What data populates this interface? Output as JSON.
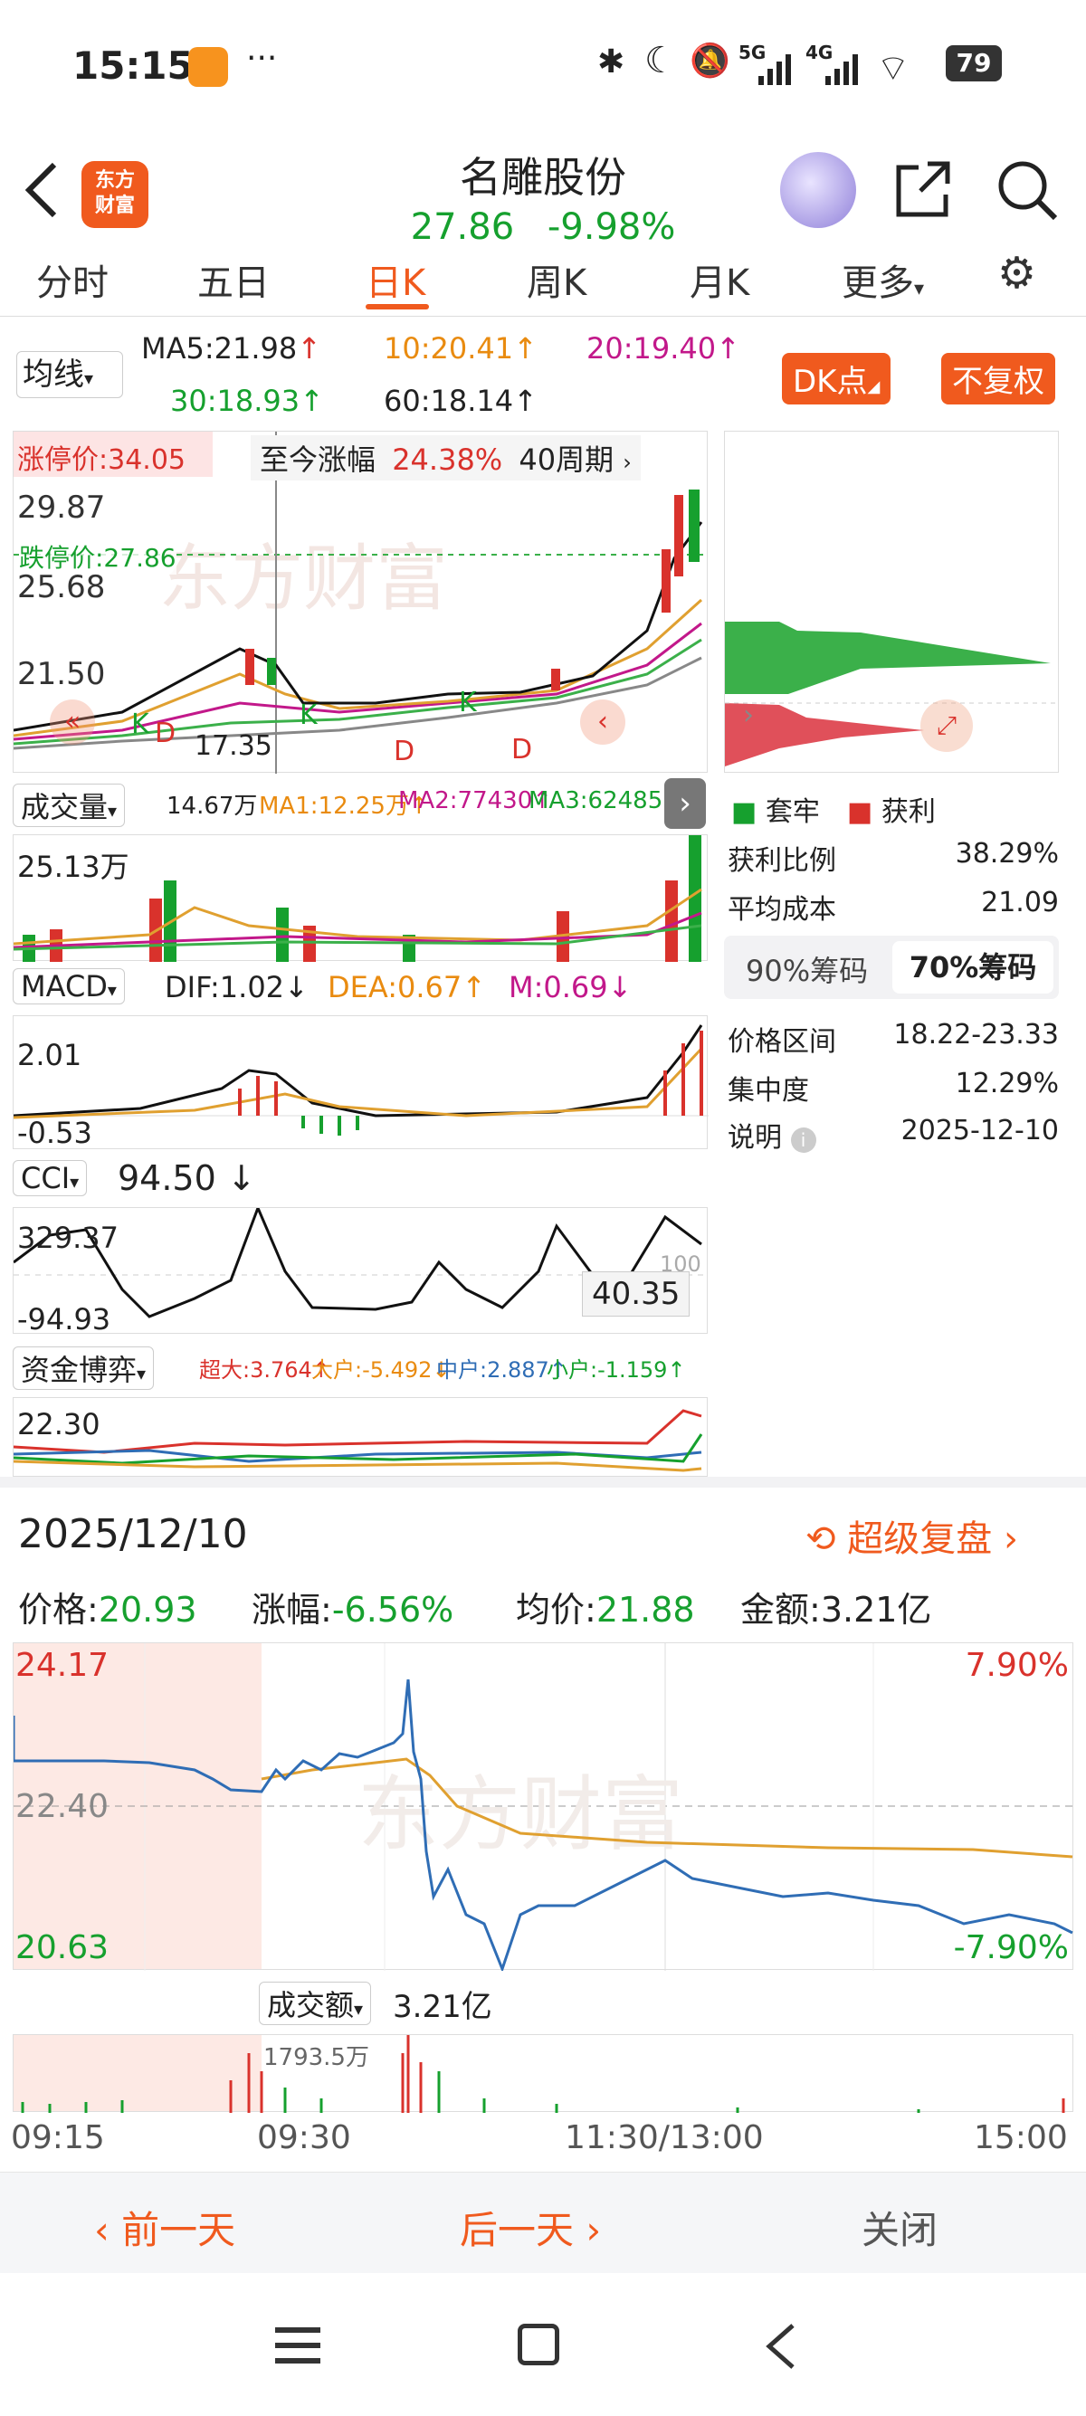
{
  "status_bar": {
    "time": "15:15",
    "network_labels": [
      "5G",
      "4G"
    ],
    "battery": "79"
  },
  "header": {
    "back_icon": "back-chevron-icon",
    "app_logo": "东方财富",
    "stock_name": "名雕股份",
    "price": "27.86",
    "change_pct": "-9.98%"
  },
  "tabs": [
    "分时",
    "五日",
    "日K",
    "周K",
    "月K",
    "更多"
  ],
  "active_tab": "日K",
  "ma_row": {
    "select": "均线",
    "ma5": "MA5:21.98",
    "ma10": "10:20.41",
    "ma20": "20:19.40",
    "ma30": "30:18.93",
    "ma60": "60:18.14",
    "dk_button": "DK点",
    "adjust_button": "不复权"
  },
  "kchart": {
    "limit_up_label": "涨停价:34.05",
    "range_label": "至今涨幅",
    "range_value": "24.38%",
    "period": "40周期",
    "y_labels": [
      "29.87",
      "25.68",
      "21.50"
    ],
    "limit_down_label": "跌停价:27.86",
    "low_label": "17.35",
    "k_marks": [
      "K",
      "D",
      "K",
      "K",
      "D",
      "D"
    ],
    "watermark": "东方财富"
  },
  "chips": {
    "legend_hold": "套牢",
    "legend_profit": "获利",
    "profit_ratio_label": "获利比例",
    "profit_ratio": "38.29%",
    "avg_cost_label": "平均成本",
    "avg_cost": "21.09",
    "tab_90": "90%筹码",
    "tab_70": "70%筹码",
    "price_range_label": "价格区间",
    "price_range": "18.22-23.33",
    "concentration_label": "集中度",
    "concentration": "12.29%",
    "note_label": "说明",
    "note_date": "2025-12-10"
  },
  "volume": {
    "select": "成交量",
    "vol": "14.67万",
    "ma1": "MA1:12.25万",
    "ma2": "MA2:77430",
    "ma3": "MA3:62485",
    "y_label": "25.13万"
  },
  "macd": {
    "select": "MACD",
    "dif": "DIF:1.02",
    "dea": "DEA:0.67",
    "m": "M:0.69",
    "y_top": "2.01",
    "y_bottom": "-0.53"
  },
  "cci": {
    "select": "CCI",
    "value": "94.50",
    "y_top": "329.37",
    "y_bottom": "-94.93",
    "y_mid": "100",
    "tooltip": "40.35"
  },
  "fund": {
    "select": "资金博弈",
    "super": "超大:3.764",
    "large": "大户:-5.492",
    "medium": "中户:2.887",
    "small": "小户:-1.159",
    "y_label": "22.30"
  },
  "day": {
    "date": "2025/12/10",
    "replay": "超级复盘",
    "price_label": "价格:",
    "price": "20.93",
    "change_label": "涨幅:",
    "change": "-6.56%",
    "avg_label": "均价:",
    "avg": "21.88",
    "amount_label": "金额:",
    "amount": "3.21亿",
    "y_high": "24.17",
    "y_mid": "22.40",
    "y_low": "20.63",
    "pct_high": "7.90%",
    "pct_low": "-7.90%",
    "vol_select": "成交额",
    "vol_total": "3.21亿",
    "vol_peak": "1793.5万",
    "times": [
      "09:15",
      "09:30",
      "11:30/13:00",
      "15:00"
    ]
  },
  "bottom": {
    "prev": "前一天",
    "next": "后一天",
    "close": "关闭"
  },
  "colors": {
    "accent": "#f05a1e",
    "up": "#d9322c",
    "down": "#16a02e",
    "price_line": "#2f6db5",
    "avg_line": "#e0a030"
  }
}
